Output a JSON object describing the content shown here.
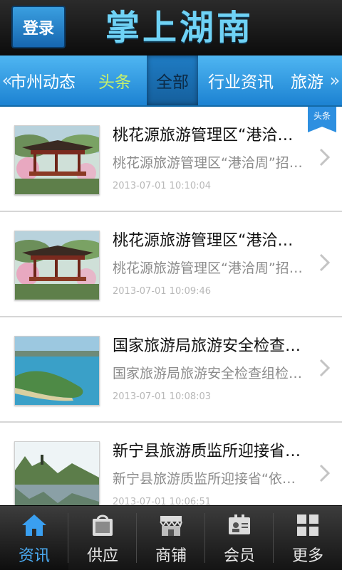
{
  "header": {
    "login_label": "登录",
    "app_title": "掌上湖南"
  },
  "categories": {
    "left_arrow": "«",
    "right_arrow": "»",
    "items": [
      {
        "label": "市州动态"
      },
      {
        "label": "头条"
      },
      {
        "label": "全部"
      },
      {
        "label": "行业资讯"
      },
      {
        "label": "旅游"
      }
    ]
  },
  "news": {
    "badge_label": "头条",
    "items": [
      {
        "title": "桃花源旅游管理区“港洽周”招商",
        "summary": "桃花源旅游管理区“港洽周”招商引资",
        "time": "2013-07-01 10:10:04",
        "thumb_icon": "pavilion-photo"
      },
      {
        "title": "桃花源旅游管理区“港洽周”招商",
        "summary": "桃花源旅游管理区“港洽周”招商引资",
        "time": "2013-07-01 10:09:46",
        "thumb_icon": "pavilion-photo"
      },
      {
        "title": "国家旅游局旅游安全检查组检查",
        "summary": "国家旅游局旅游安全检查组检查湖南",
        "time": "2013-07-01 10:08:03",
        "thumb_icon": "island-aerial-photo"
      },
      {
        "title": "新宁县旅游质监所迎接省依法治旅",
        "summary": "新宁县旅游质监所迎接省“依法治旅”",
        "time": "2013-07-01 10:06:51",
        "thumb_icon": "lake-mountain-photo"
      }
    ]
  },
  "tabbar": {
    "items": [
      {
        "label": "资讯",
        "icon": "home-icon"
      },
      {
        "label": "供应",
        "icon": "shopping-bag-icon"
      },
      {
        "label": "商铺",
        "icon": "storefront-icon"
      },
      {
        "label": "会员",
        "icon": "member-card-icon"
      },
      {
        "label": "更多",
        "icon": "grid-icon"
      }
    ]
  },
  "colors": {
    "accent": "#2d8fe0",
    "header_bg": "#1a1a1a",
    "title": "#6fd2f5",
    "hot_category": "#c7f06a",
    "active_tab_label": "#4aa9f0"
  }
}
